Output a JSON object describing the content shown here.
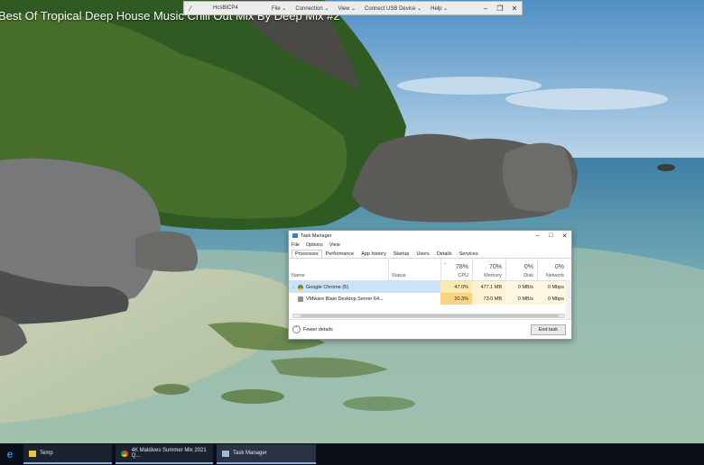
{
  "video": {
    "title": "Best Of Tropical Deep House Music Chill Out Mix By Deep Mix #2"
  },
  "remote_bar": {
    "host": "HcsBICP4",
    "menus": [
      "File",
      "Connection",
      "View",
      "Connect USB Device",
      "Help"
    ]
  },
  "task_manager": {
    "title": "Task Manager",
    "menu": [
      "File",
      "Options",
      "View"
    ],
    "tabs": [
      "Processes",
      "Performance",
      "App history",
      "Startup",
      "Users",
      "Details",
      "Services"
    ],
    "columns": {
      "name": "Name",
      "status": "Status",
      "cpu": {
        "pct": "78%",
        "label": "CPU"
      },
      "memory": {
        "pct": "70%",
        "label": "Memory"
      },
      "disk": {
        "pct": "0%",
        "label": "Disk"
      },
      "network": {
        "pct": "0%",
        "label": "Network"
      }
    },
    "rows": [
      {
        "name": "Google Chrome (5)",
        "status": "",
        "cpu": "47.0%",
        "memory": "477.1 MB",
        "disk": "0 MB/s",
        "network": "0 Mbps"
      },
      {
        "name": "VMware Blast Desktop Server 64...",
        "status": "",
        "cpu": "20.3%",
        "memory": "73.0 MB",
        "disk": "0 MB/s",
        "network": "0 Mbps"
      }
    ],
    "fewer_details": "Fewer details",
    "end_task": "End task"
  },
  "taskbar": {
    "items": [
      "Temp",
      "4K Maldives Summer Mix 2021 Q...",
      "Task Manager"
    ]
  },
  "colors": {
    "cpu_high": "#f9d47e",
    "cpu_med": "#fbe9b4",
    "mem_tint": "#fdf3d4",
    "selection": "#cce3f7",
    "taskbar": "#0a0f1a"
  }
}
